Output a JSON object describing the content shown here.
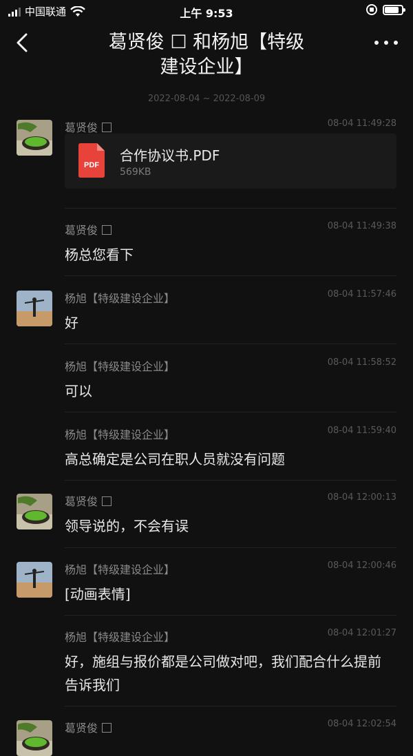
{
  "status_bar": {
    "carrier": "中国联通",
    "time": "上午 9:53",
    "battery_level": 0.9
  },
  "header": {
    "title_line1": "葛贤俊 ☐ 和杨旭【特级",
    "title_line2": "建设企业】"
  },
  "date_range": "2022-08-04 ~ 2022-08-09",
  "messages": [
    {
      "sender": "葛贤俊",
      "time": "08-04 11:49:28",
      "file": {
        "name": "合作协议书.PDF",
        "size": "569KB",
        "badge": "PDF"
      }
    },
    {
      "sender": "葛贤俊",
      "time": "08-04 11:49:38",
      "text": "杨总您看下"
    },
    {
      "sender": "杨旭【特级建设企业】",
      "time": "08-04 11:57:46",
      "text": "好"
    },
    {
      "sender": "杨旭【特级建设企业】",
      "time": "08-04 11:58:52",
      "text": "可以"
    },
    {
      "sender": "杨旭【特级建设企业】",
      "time": "08-04 11:59:40",
      "text": "高总确定是公司在职人员就没有问题"
    },
    {
      "sender": "葛贤俊",
      "time": "08-04 12:00:13",
      "text": "领导说的，不会有误"
    },
    {
      "sender": "杨旭【特级建设企业】",
      "time": "08-04 12:00:46",
      "text": "[动画表情]"
    },
    {
      "sender": "杨旭【特级建设企业】",
      "time": "08-04 12:01:27",
      "text": "好，施组与报价都是公司做对吧，我们配合什么提前告诉我们"
    },
    {
      "sender": "葛贤俊",
      "time": "08-04 12:02:54"
    }
  ],
  "colors": {
    "background": "#111111",
    "pdf_red": "#e8433a"
  }
}
